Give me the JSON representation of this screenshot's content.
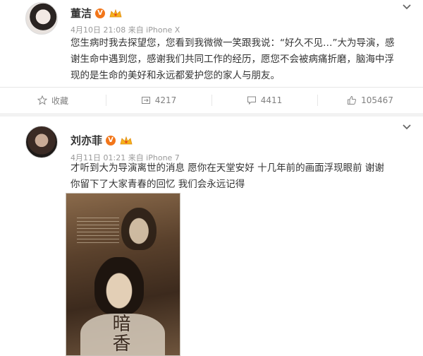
{
  "posts": [
    {
      "author": "董洁",
      "verified_badge": "V",
      "meta": "4月10日 21:08 来自 iPhone X",
      "text": "您生病时我去探望您，您看到我微微一笑跟我说：“好久不见…”大为导演，感谢生命中遇到您，感谢我们共同工作的经历，愿您不会被病痛折磨，脑海中浮现的是生命的美好和永远都爱护您的家人与朋友。",
      "actions": {
        "favorite_label": "收藏",
        "repost_count": "4217",
        "comment_count": "4411",
        "like_count": "105467"
      }
    },
    {
      "author": "刘亦菲",
      "verified_badge": "V",
      "meta": "4月11日 01:21 来自 iPhone 7",
      "text": "才听到大为导演离世的消息 愿你在天堂安好 十几年前的画面浮现眼前 谢谢你留下了大家青春的回忆 我们会永远记得",
      "poster_title": "暗香"
    }
  ],
  "icons": {
    "chevron": "chevron-down-icon",
    "favorite": "star-icon",
    "repost": "repost-icon",
    "comment": "comment-icon",
    "like": "thumb-up-icon",
    "member": "crown-icon"
  },
  "colors": {
    "badge": "#f2761a",
    "meta_text": "#999999",
    "divider": "#e6e6e6"
  }
}
